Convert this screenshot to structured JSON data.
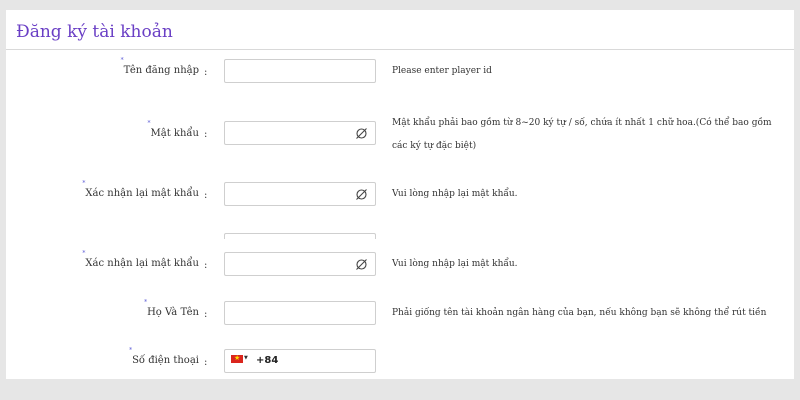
{
  "form": {
    "title": "Đăng ký tài khoản",
    "required_mark": "*",
    "colon": ":",
    "fields": [
      {
        "label": "Tên đăng nhập",
        "value": "",
        "help": "Please enter player id"
      },
      {
        "label": "Mật khẩu",
        "value": "",
        "help_lines": [
          "Mật khẩu phải bao gồm từ 8~20 ký tự / số, chứa ít nhất 1 chữ hoa.(Có thể bao gồm",
          "các ký tự đặc biệt)"
        ]
      },
      {
        "label": "Xác nhận lại mật khẩu",
        "value": "",
        "help": "Vui lòng nhập lại mật khẩu."
      },
      {
        "label": "Xác nhận lại mật khẩu",
        "value": "",
        "help": "Vui lòng nhập lại mật khẩu."
      },
      {
        "label": "Họ Và Tên",
        "value": "",
        "help": "Phải giống tên tài khoản ngân hàng của bạn, nếu không bạn sẽ không thể rút tiền"
      },
      {
        "label": "Số điện thoại",
        "country_flag": "vietnam-flag-icon",
        "dial_code": "+84"
      }
    ]
  },
  "colors": {
    "title": "#6a3fc5",
    "required_mark": "#5b5bd6",
    "page_background": "#e6e6e6"
  }
}
